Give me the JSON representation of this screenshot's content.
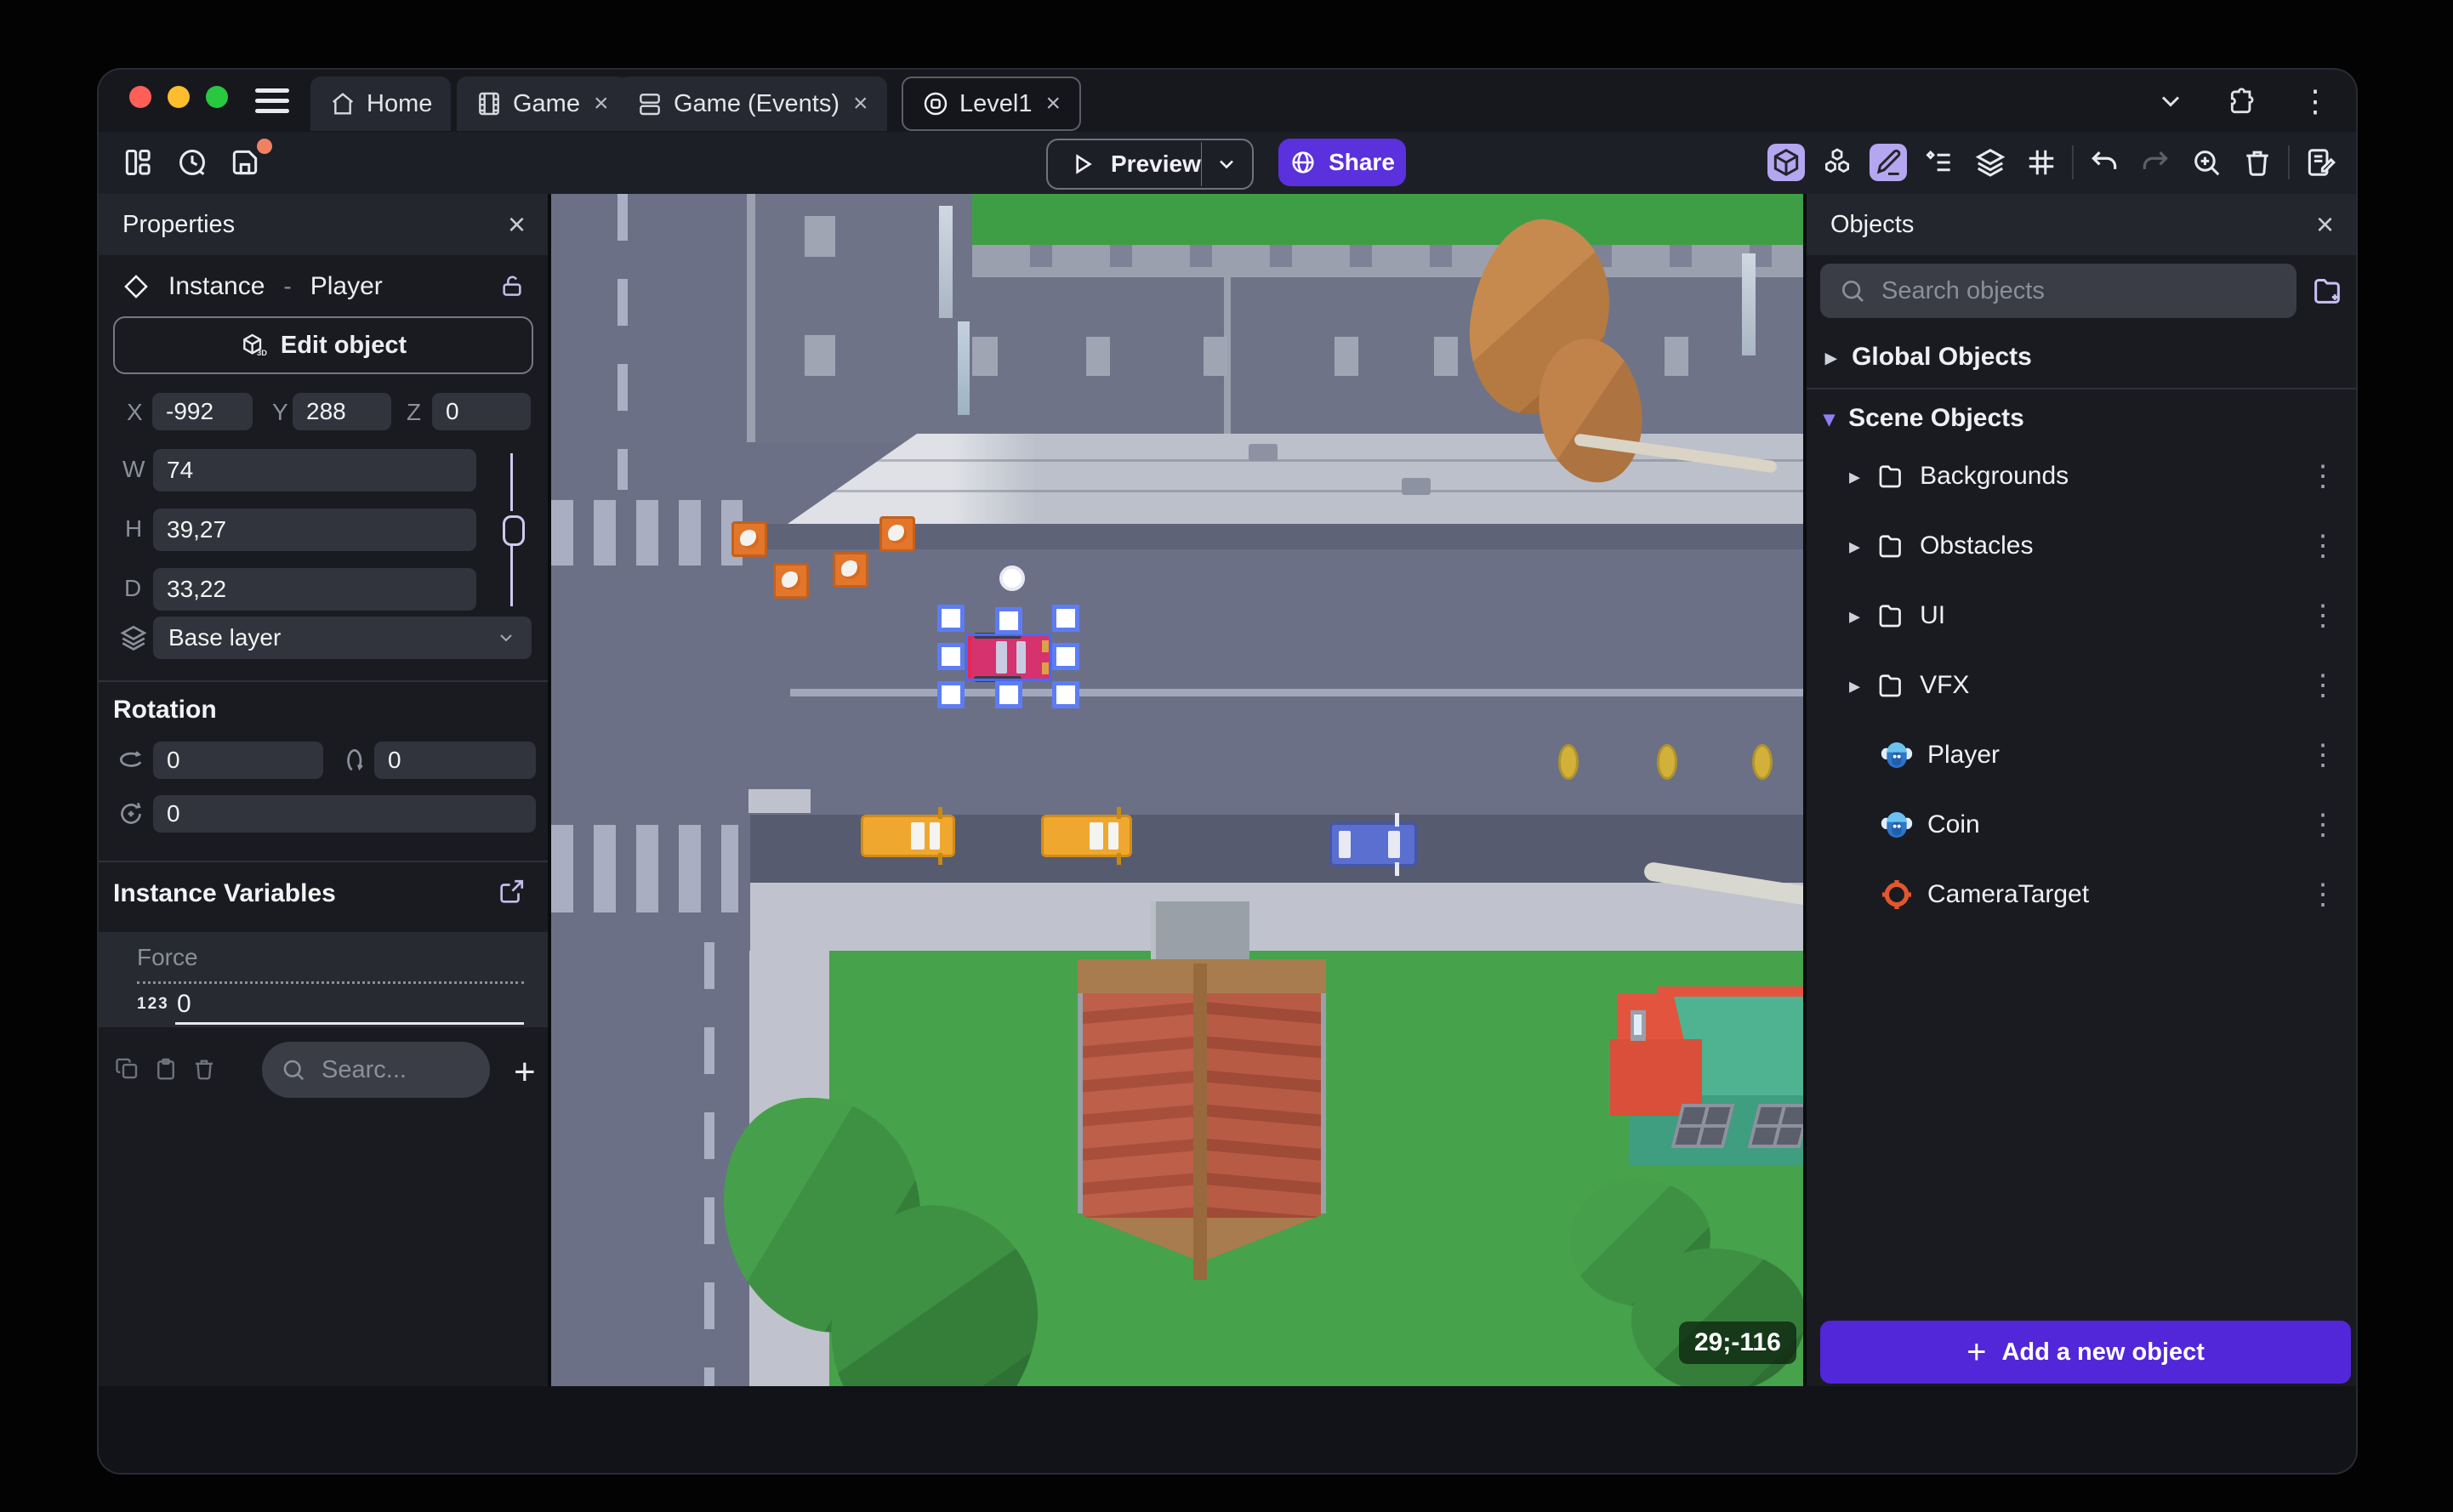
{
  "window": {
    "tabs": [
      {
        "label": "Home",
        "icon": "home-icon",
        "closable": false,
        "active": false
      },
      {
        "label": "Game",
        "icon": "film-icon",
        "closable": true,
        "active": false,
        "close_glyph": "×"
      },
      {
        "label": "Game (Events)",
        "icon": "events-icon",
        "closable": true,
        "active": false,
        "close_glyph": "×"
      },
      {
        "label": "Level1",
        "icon": "scene-icon",
        "closable": true,
        "active": true,
        "close_glyph": "×"
      }
    ]
  },
  "toolbar": {
    "preview_label": "Preview",
    "share_label": "Share"
  },
  "properties_panel": {
    "title": "Properties",
    "instance_kind": "Instance",
    "separator": "-",
    "object_name": "Player",
    "edit_object_label": "Edit object",
    "position": {
      "x_label": "X",
      "x": "-992",
      "y_label": "Y",
      "y": "288",
      "z_label": "Z",
      "z": "0"
    },
    "size": {
      "w_label": "W",
      "w": "74",
      "h_label": "H",
      "h": "39,27",
      "d_label": "D",
      "d": "33,22"
    },
    "layer": {
      "value": "Base layer"
    },
    "rotation": {
      "title": "Rotation",
      "rx": "0",
      "ry": "0",
      "rz": "0"
    },
    "variables": {
      "title": "Instance Variables",
      "rows": [
        {
          "name": "Force",
          "type_badge": "123",
          "value": "0"
        }
      ],
      "search_placeholder": "Searc...",
      "add_label": "+"
    }
  },
  "canvas": {
    "cursor_coordinates": "29;-116"
  },
  "objects_panel": {
    "title": "Objects",
    "search_placeholder": "Search objects",
    "groups": [
      {
        "label": "Global Objects",
        "expanded": false
      },
      {
        "label": "Scene Objects",
        "expanded": true
      }
    ],
    "items": [
      {
        "label": "Backgrounds",
        "type": "folder"
      },
      {
        "label": "Obstacles",
        "type": "folder"
      },
      {
        "label": "UI",
        "type": "folder"
      },
      {
        "label": "VFX",
        "type": "folder"
      },
      {
        "label": "Player",
        "type": "sprite"
      },
      {
        "label": "Coin",
        "type": "sprite"
      },
      {
        "label": "CameraTarget",
        "type": "camera-target"
      }
    ],
    "kebab_glyph": "⋮",
    "add_button_label": "Add a new object"
  },
  "colors": {
    "accent_purple": "#5b30dd",
    "active_tool_bg": "#b5a6f0",
    "selection_blue": "#5d7cf5",
    "unsaved_dot": "#f08161",
    "traffic_red": "#ff5f57",
    "traffic_yellow": "#febc2e",
    "traffic_green": "#28c840",
    "camera_target_orange": "#e2572e",
    "grass_green": "#46a24b",
    "road_gray": "#6b7086"
  }
}
